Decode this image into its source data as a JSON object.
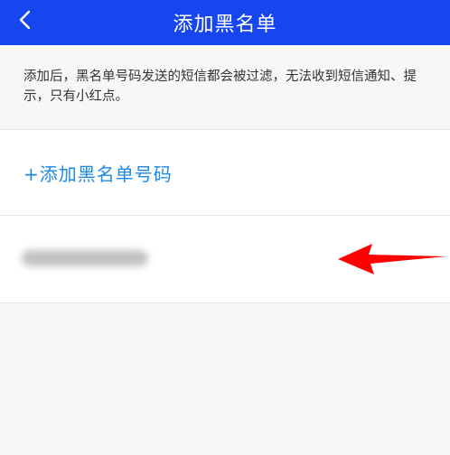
{
  "header": {
    "title": "添加黑名单",
    "back_icon": "chevron-left-icon",
    "background_color": "#1746ee"
  },
  "notice": {
    "text": "添加后，黑名单号码发送的短信都会被过滤，无法收到短信通知、提示，只有小红点。"
  },
  "actions": {
    "add_label": "+添加黑名单号码",
    "link_color": "#1e88e5"
  },
  "blacklist": {
    "entries": [
      {
        "number_state": "blurred"
      }
    ]
  },
  "annotation": {
    "arrow_icon": "red-arrow-left-icon",
    "color": "#ff0000"
  }
}
